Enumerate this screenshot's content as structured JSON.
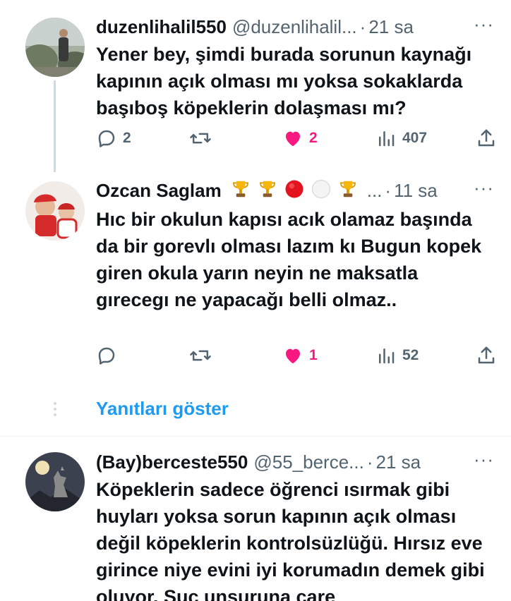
{
  "tweets": [
    {
      "name": "duzenlihalil550",
      "handle": "@duzenlihalil...",
      "dot": "·",
      "time": "21 sa",
      "more": "···",
      "text": "Yener bey, şimdi burada sorunun kaynağı kapının açık olması mı yoksa sokaklarda başıboş köpeklerin dolaşması mı?",
      "replies": "2",
      "retweets": "",
      "likes": "2",
      "views": "407"
    },
    {
      "name": "Ozcan Saglam",
      "badges": [
        "trophy-icon",
        "trophy-icon",
        "red-circle-icon",
        "white-circle-icon",
        "trophy-icon"
      ],
      "handle": "...",
      "dot": "·",
      "time": "11 sa",
      "more": "···",
      "text": "Hıc bir okulun kapısı acık olamaz başında da bir gorevlı olması lazım kı Bugun kopek giren okula yarın neyin ne maksatla gırecegı ne yapacağı belli olmaz..",
      "replies": "",
      "retweets": "",
      "likes": "1",
      "views": "52"
    },
    {
      "name": "(Bay)berceste550",
      "handle": "@55_berce...",
      "dot": "·",
      "time": "21 sa",
      "more": "···",
      "text": "Köpeklerin sadece öğrenci ısırmak gibi huyları yoksa sorun kapının açık olması değil köpeklerin kontrolsüzlüğü. Hırsız eve girince niye evini iyi korumadın demek gibi oluyor. Suç unsuruna çare"
    }
  ],
  "show_replies": "Yanıtları göster",
  "colors": {
    "like_pink": "#f91880",
    "link_blue": "#1d9bf0",
    "secondary": "#536471"
  }
}
